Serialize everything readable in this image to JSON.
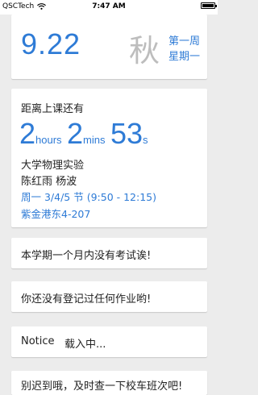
{
  "status_bar": {
    "carrier": "QSCTech",
    "time": "7:47 AM"
  },
  "date_card": {
    "week_number": "9.22",
    "season": "秋",
    "week_label": "第一周",
    "day_label": "星期一"
  },
  "countdown_card": {
    "title": "距离上课还有",
    "hours_value": "2",
    "hours_unit": "hours",
    "mins_value": "2",
    "mins_unit": "mins",
    "secs_value": "53",
    "secs_unit": "s",
    "course": "大学物理实验",
    "teachers": "陈红雨 杨波",
    "time_slot": "周一 3/4/5 节 (9:50 - 12:15)",
    "location": "紫金港东4-207"
  },
  "messages": {
    "exam": "本学期一个月内没有考试诶!",
    "homework": "你还没有登记过任何作业哟!",
    "notice_label": "Notice",
    "notice_status": "载入中...",
    "partial": "别迟到哦，及时查一下校车班次吧!"
  },
  "colors": {
    "accent": "#2e7bd6",
    "background": "#ececec",
    "card": "#ffffff",
    "season_gray": "#bdbdbd"
  }
}
